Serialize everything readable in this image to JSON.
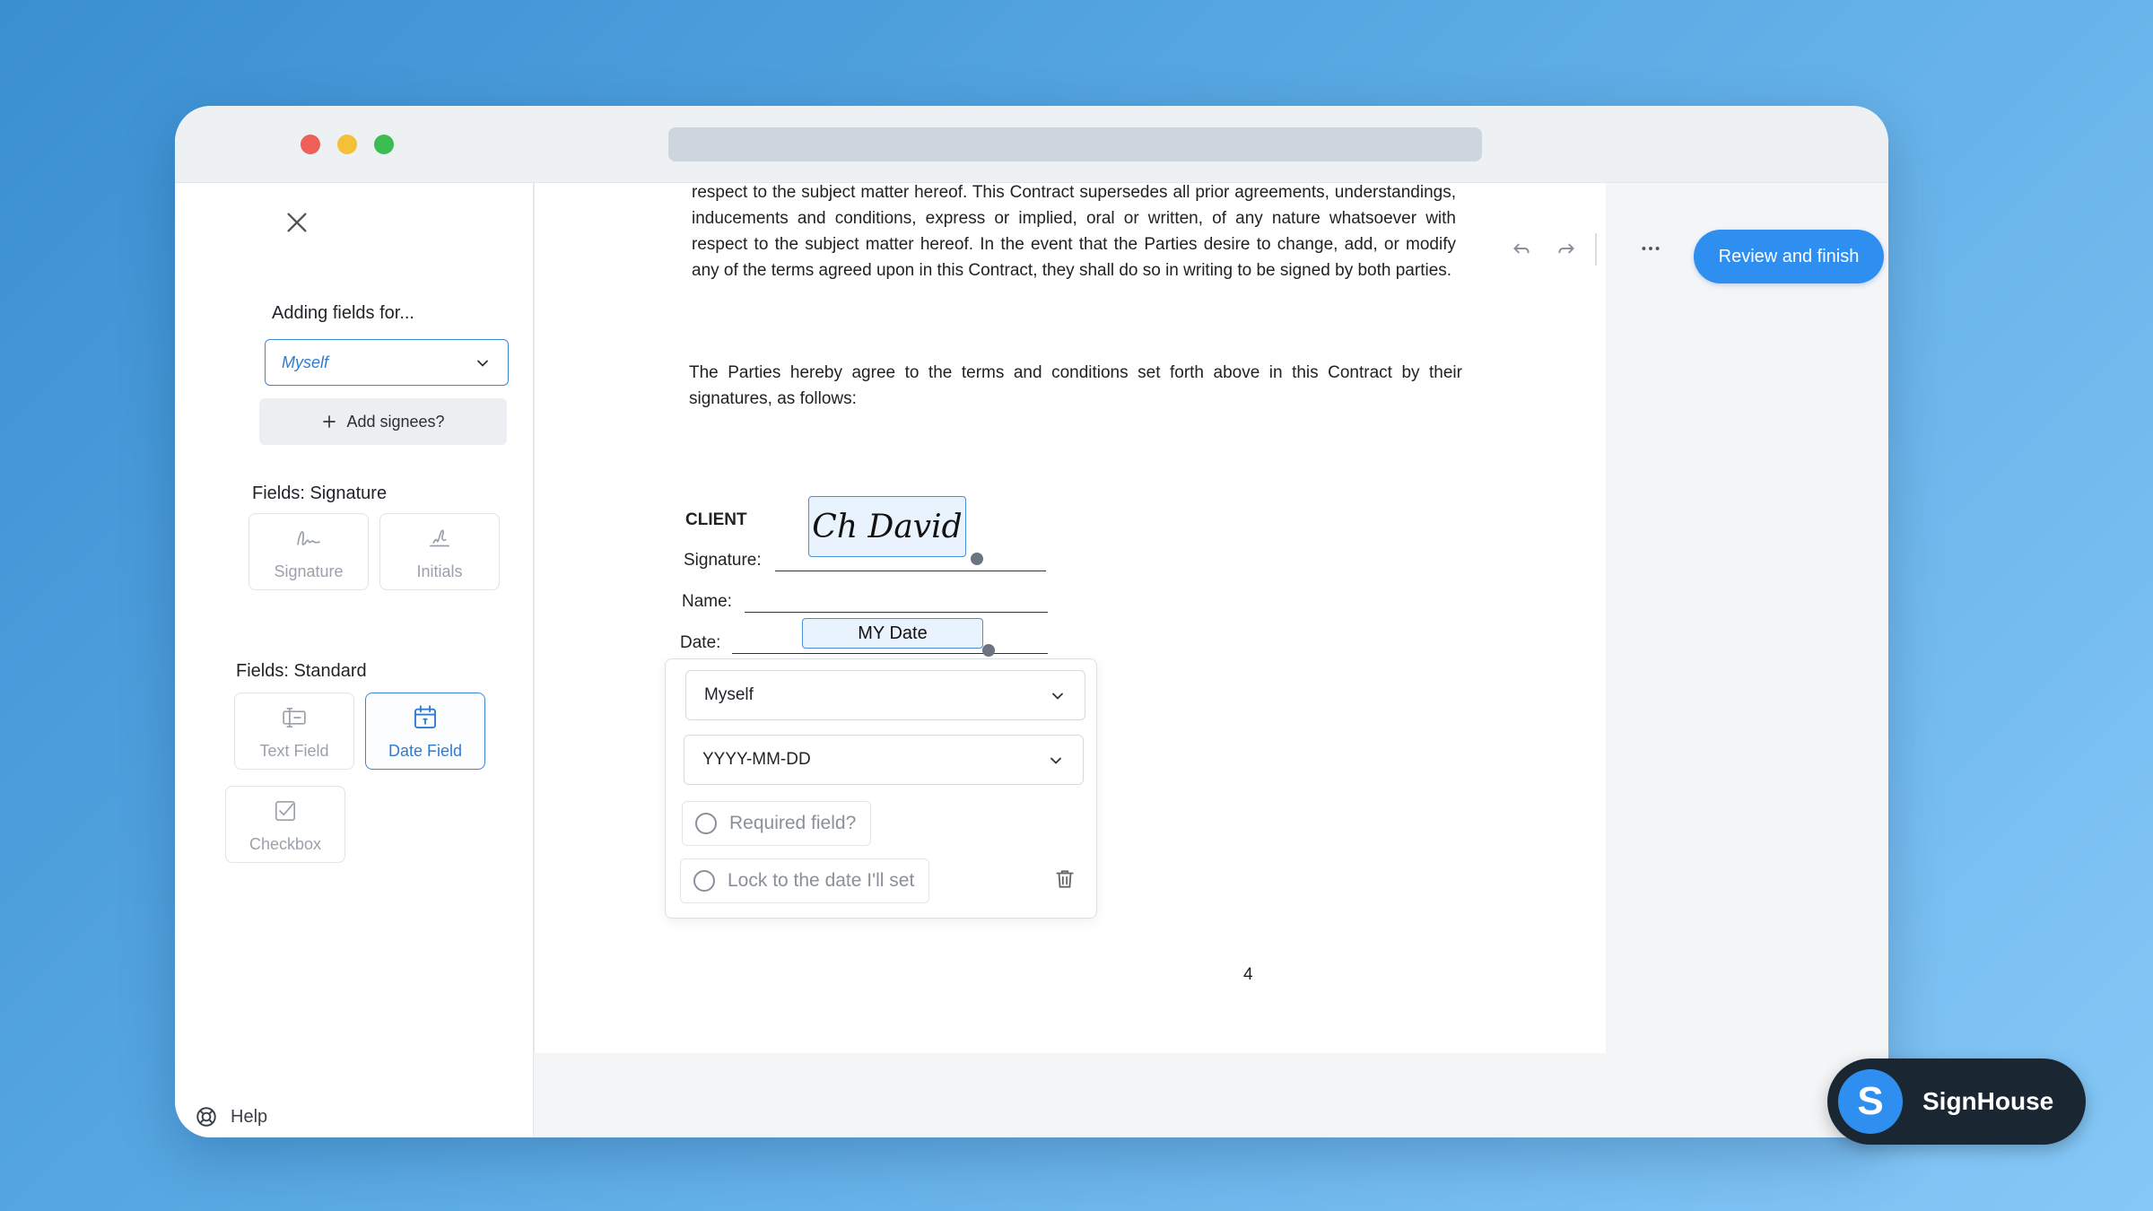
{
  "sidebar": {
    "adding_for_label": "Adding fields for...",
    "signee_value": "Myself",
    "add_signees_label": "Add signees?",
    "signature_section_label": "Fields: Signature",
    "signature_fields": [
      "Signature",
      "Initials"
    ],
    "standard_section_label": "Fields: Standard",
    "standard_fields": [
      "Text Field",
      "Date Field",
      "Checkbox"
    ],
    "help_label": "Help"
  },
  "document": {
    "paragraph1": "respect to the subject matter hereof. This Contract supersedes all prior agreements, understandings, inducements and conditions, express or implied, oral or written, of any nature whatsoever with respect to the subject matter hereof. In the event that the Parties desire to change, add, or modify any of the terms agreed upon in this Contract, they shall do so in writing to be signed by both parties.",
    "paragraph2": "The Parties hereby agree to the terms and conditions set forth above in this Contract by their signatures, as follows:",
    "client_label": "CLIENT",
    "signature_label": "Signature:",
    "name_label": "Name:",
    "date_label": "Date:",
    "signature_value": "Ch David",
    "date_field_value": "MY Date",
    "page_number": "4"
  },
  "date_popup": {
    "signee_value": "Myself",
    "format_value": "YYYY-MM-DD",
    "required_label": "Required field?",
    "lock_label": "Lock to the date I'll set"
  },
  "toolbar": {
    "review_label": "Review and finish",
    "icons": [
      "undo-icon",
      "redo-icon",
      "more-icon"
    ]
  },
  "brand": {
    "logo_letter": "S",
    "name": "SignHouse"
  },
  "colors": {
    "accent": "#2e8ff0",
    "field_highlight": "#e8f3fd",
    "brand_dark": "#1b2633"
  }
}
